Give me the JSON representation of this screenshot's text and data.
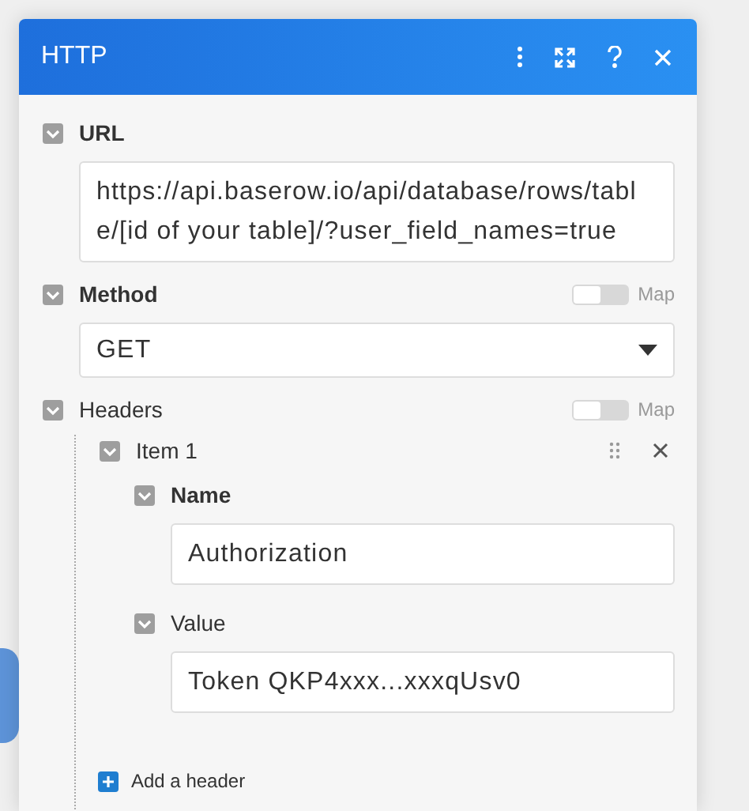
{
  "panel": {
    "title": "HTTP"
  },
  "fields": [
    {
      "kind": "text",
      "label": "URL",
      "required": true,
      "expanded": true,
      "value": "https://api.baserow.io/api/database/rows/table/[id of your table]/?user_field_names=true"
    },
    {
      "kind": "select",
      "label": "Method",
      "required": true,
      "expanded": true,
      "map": {
        "label": "Map",
        "on": false
      },
      "value": "GET"
    },
    {
      "kind": "array",
      "label": "Headers",
      "required": false,
      "expanded": true,
      "map": {
        "label": "Map",
        "on": false
      },
      "items": [
        {
          "label": "Item 1",
          "expanded": true,
          "fields": [
            {
              "kind": "text",
              "label": "Name",
              "required": true,
              "expanded": true,
              "value": "Authorization"
            },
            {
              "kind": "text",
              "label": "Value",
              "required": false,
              "expanded": true,
              "value": "Token QKP4xxx...xxxqUsv0"
            }
          ]
        }
      ],
      "add_label": "Add a header"
    }
  ]
}
